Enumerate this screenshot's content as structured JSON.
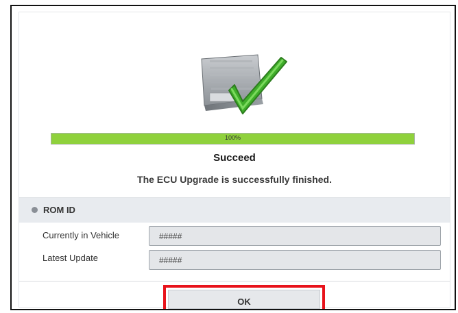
{
  "progress": {
    "value": 1.0,
    "label": "100%"
  },
  "status": {
    "title": "Succeed",
    "message": "The ECU Upgrade is successfully finished."
  },
  "rom": {
    "section_label": "ROM ID",
    "rows": [
      {
        "label": "Currently in Vehicle",
        "value": "#####"
      },
      {
        "label": "Latest Update",
        "value": "#####"
      }
    ]
  },
  "buttons": {
    "ok_label": "OK"
  },
  "icons": {
    "ecu": "ecu-module-icon",
    "success": "green-checkmark-icon"
  },
  "colors": {
    "progress_fill": "#8fd13c",
    "highlight": "#e8131b",
    "check": "#3fae2a"
  }
}
